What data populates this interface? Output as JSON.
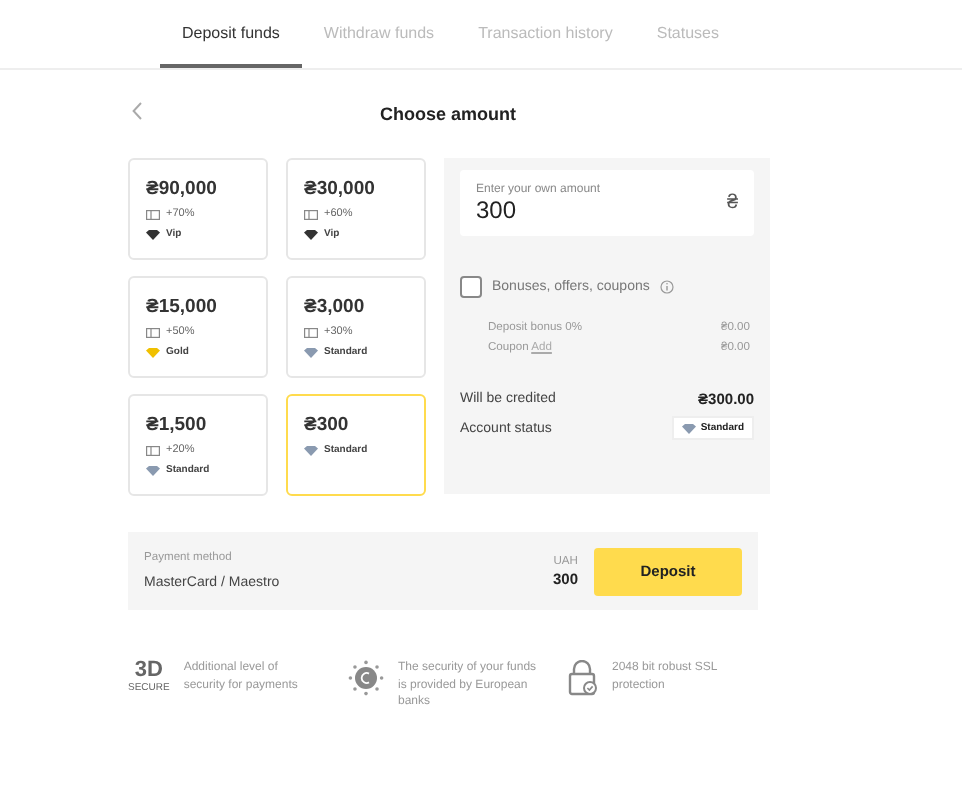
{
  "tabs": [
    {
      "label": "Deposit funds",
      "selected": true
    },
    {
      "label": "Withdraw funds",
      "selected": false
    },
    {
      "label": "Transaction history",
      "selected": false
    },
    {
      "label": "Statuses",
      "selected": false
    }
  ],
  "header": {
    "title": "Choose amount"
  },
  "amounts": [
    {
      "amount": "₴90,000",
      "bonus": "+70%",
      "status": "Vip",
      "kind": "vip",
      "selected": false
    },
    {
      "amount": "₴30,000",
      "bonus": "+60%",
      "status": "Vip",
      "kind": "vip",
      "selected": false
    },
    {
      "amount": "₴15,000",
      "bonus": "+50%",
      "status": "Gold",
      "kind": "gold",
      "selected": false
    },
    {
      "amount": "₴3,000",
      "bonus": "+30%",
      "status": "Standard",
      "kind": "standard",
      "selected": false
    },
    {
      "amount": "₴1,500",
      "bonus": "+20%",
      "status": "Standard",
      "kind": "standard",
      "selected": false
    },
    {
      "amount": "₴300",
      "status": "Standard",
      "kind": "standard",
      "selected": true
    }
  ],
  "custom_amount": {
    "label": "Enter your own amount",
    "value": "300",
    "currency_symbol": "₴"
  },
  "bonuses": {
    "label": "Bonuses, offers, coupons",
    "checked": false,
    "rows": [
      {
        "label": "Deposit bonus 0%",
        "value": "₴0.00"
      },
      {
        "label": "Coupon",
        "link": "Add",
        "value": "₴0.00"
      }
    ]
  },
  "summary": {
    "credited_label": "Will be credited",
    "credited_value": "₴300.00",
    "status_label": "Account status",
    "status": "Standard",
    "kind": "standard"
  },
  "payment": {
    "label": "Payment method",
    "method": "MasterCard / Maestro",
    "currency": "UAH",
    "amount": "300",
    "button": "Deposit"
  },
  "features": [
    {
      "kind": "secure3d",
      "logo": "3D",
      "logo_sub": "SECURE",
      "text": "Additional level of security for payments"
    },
    {
      "kind": "bank",
      "text": "The security of your funds is provided by European banks"
    },
    {
      "kind": "lock",
      "text": "2048 bit robust SSL protection"
    }
  ]
}
